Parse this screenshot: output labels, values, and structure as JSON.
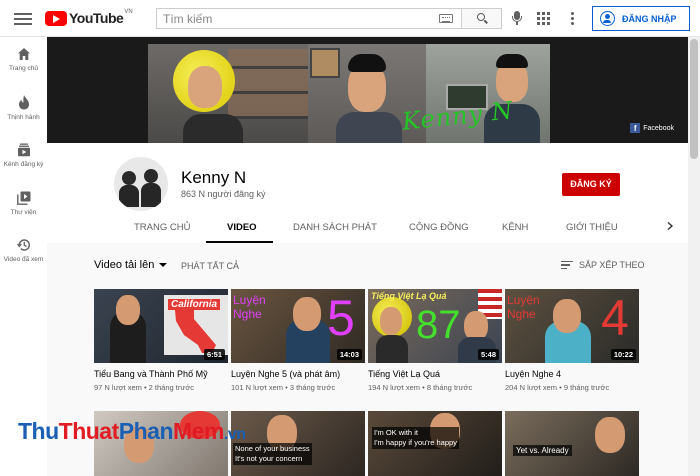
{
  "header": {
    "logo_text": "YouTube",
    "logo_country": "VN",
    "search_placeholder": "Tìm kiếm",
    "signin_label": "ĐĂNG NHẬP"
  },
  "sidebar": {
    "items": [
      {
        "label": "Trang chủ",
        "icon": "home-icon"
      },
      {
        "label": "Thịnh hành",
        "icon": "flame-icon"
      },
      {
        "label": "Kênh đăng ký",
        "icon": "subscriptions-icon"
      },
      {
        "label": "Thư viện",
        "icon": "library-icon"
      },
      {
        "label": "Video đã xem",
        "icon": "history-icon"
      }
    ]
  },
  "banner": {
    "signature": "Kenny N",
    "facebook_label": "Facebook"
  },
  "channel": {
    "name": "Kenny N",
    "subscribers": "863 N người đăng ký",
    "subscribe_label": "ĐĂNG KÝ",
    "tabs": [
      "TRANG CHỦ",
      "VIDEO",
      "DANH SÁCH PHÁT",
      "CỘNG ĐỒNG",
      "KÊNH",
      "GIỚI THIỆU"
    ],
    "active_tab": "VIDEO"
  },
  "filters": {
    "sort_dropdown": "Video tải lên",
    "play_all": "PHÁT TẤT CẢ",
    "sort_by": "SẮP XẾP THEO"
  },
  "videos": [
    {
      "title": "Tiểu Bang và Thành Phố Mỹ",
      "meta": "97 N lượt xem • 2 tháng trước",
      "duration": "6:51",
      "overlay": "California"
    },
    {
      "title": "Luyện Nghe 5 (và phát âm)",
      "meta": "101 N lượt xem • 3 tháng trước",
      "duration": "14:03",
      "overlay": "Luyện Nghe",
      "overlay_number": "5"
    },
    {
      "title": "Tiếng Việt Lạ Quá",
      "meta": "194 N lượt xem • 8 tháng trước",
      "duration": "5:48",
      "overlay": "Tiếng Việt Lạ Quá",
      "overlay_number": "87"
    },
    {
      "title": "Luyện Nghe 4",
      "meta": "204 N lượt xem • 9 tháng trước",
      "duration": "10:22",
      "overlay": "Luyện Nghe",
      "overlay_number": "4"
    }
  ],
  "videos_row2": [
    {
      "overlay": ""
    },
    {
      "overlay": "None of your business\nIt's not your concern"
    },
    {
      "overlay": "I'm OK with it\nI'm happy if you're happy"
    },
    {
      "overlay": "Yet vs. Already"
    }
  ],
  "watermark": {
    "part1": "Thu",
    "part2": "Thuat",
    "part3": "Phan",
    "part4": "Mem",
    "part5": ".vn"
  },
  "colors": {
    "accent_blue": "#065fd4",
    "subscribe_red": "#cc0000",
    "youtube_red": "#ff0000"
  }
}
